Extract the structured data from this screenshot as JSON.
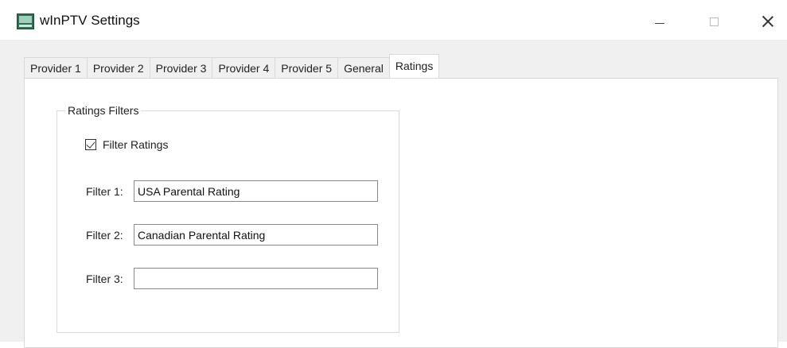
{
  "window": {
    "title": "wInPTV Settings",
    "icon": "app-icon"
  },
  "tabs": [
    {
      "label": "Provider 1",
      "active": false
    },
    {
      "label": "Provider 2",
      "active": false
    },
    {
      "label": "Provider 3",
      "active": false
    },
    {
      "label": "Provider 4",
      "active": false
    },
    {
      "label": "Provider 5",
      "active": false
    },
    {
      "label": "General",
      "active": false
    },
    {
      "label": "Ratings",
      "active": true
    }
  ],
  "ratings": {
    "group_title": "Ratings Filters",
    "filter_ratings": {
      "label": "Filter Ratings",
      "checked": true
    },
    "filters": [
      {
        "label": "Filter 1:",
        "value": "USA Parental Rating"
      },
      {
        "label": "Filter 2:",
        "value": "Canadian Parental Rating"
      },
      {
        "label": "Filter 3:",
        "value": ""
      }
    ]
  },
  "colors": {
    "dialog_background": "#f0f0f0",
    "panel_background": "#ffffff",
    "border": "#d9d9d9"
  }
}
